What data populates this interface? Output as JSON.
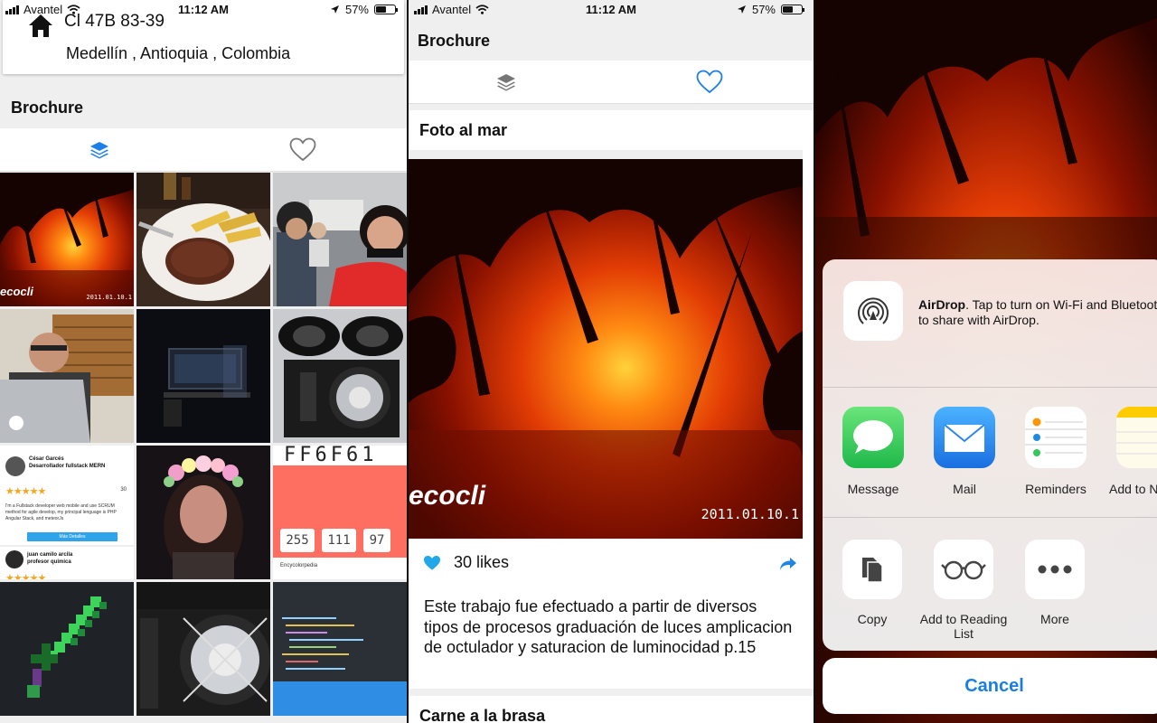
{
  "status": {
    "carrier": "Avantel",
    "time": "11:12 AM",
    "battery": "57%",
    "battery_level": 0.57
  },
  "panel1": {
    "address": {
      "street": "Cl 47B 83-39",
      "city": "Medellín , Antioquia , Colombia"
    },
    "section_title": "Brochure",
    "tabs": [
      {
        "icon": "layers-icon",
        "active": true
      },
      {
        "icon": "heart-icon",
        "active": false
      }
    ],
    "grid_texts": {
      "sunset_watermark": "ecocli",
      "sunset_date": "2011.01.10.1",
      "profile_name": "César Garcés",
      "profile_role": "Desarrollador fullstack MERN",
      "profile_count": "30",
      "profile_bio": "I'm a Fullstack developer web mobile and use SCRUM method for agile develop, my principal lenguage is PHP Angular Stack, and meteorJs",
      "profile_button": "Más Detalles",
      "profile2_name": "juan camilo arcila",
      "profile2_role": "profesor quimica",
      "hex_title": "FF6F61",
      "rgb_values": [
        "255",
        "111",
        "97"
      ],
      "encyclopedia": "Encycolorpedia"
    }
  },
  "panel2": {
    "section_title": "Brochure",
    "tabs": [
      {
        "icon": "layers-icon",
        "active": false
      },
      {
        "icon": "heart-icon",
        "active": true
      }
    ],
    "post": {
      "title": "Foto al mar",
      "watermark": "ecocli",
      "date_stamp": "2011.01.10.1",
      "likes": "30 likes",
      "description": "Este trabajo fue efectuado a partir de diversos tipos de procesos graduación de luces amplicacion de octulador y saturacion de luminocidad p.15"
    },
    "next_post_title": "Carne a la brasa"
  },
  "panel3": {
    "airdrop": {
      "title": "AirDrop",
      "text": ". Tap to turn on Wi-Fi and Bluetooth",
      "text2": "to share with AirDrop."
    },
    "apps": [
      {
        "label": "Message",
        "icon": "messages-icon",
        "color": "#34c759"
      },
      {
        "label": "Mail",
        "icon": "mail-icon",
        "color": "#1e88f0"
      },
      {
        "label": "Reminders",
        "icon": "reminders-icon",
        "color": "#ffffff"
      },
      {
        "label": "Add to N",
        "icon": "notes-icon",
        "color": "#ffcc00"
      }
    ],
    "actions": [
      {
        "label": "Copy",
        "icon": "copy-icon"
      },
      {
        "label": "Add to Reading List",
        "icon": "reading-glasses-icon"
      },
      {
        "label": "More",
        "icon": "more-icon"
      }
    ],
    "cancel": "Cancel"
  },
  "colors": {
    "accent": "#1a7fe0",
    "heart": "#22a7e8",
    "active_tab": "#1c7ee8",
    "inactive_tab": "#777777"
  }
}
